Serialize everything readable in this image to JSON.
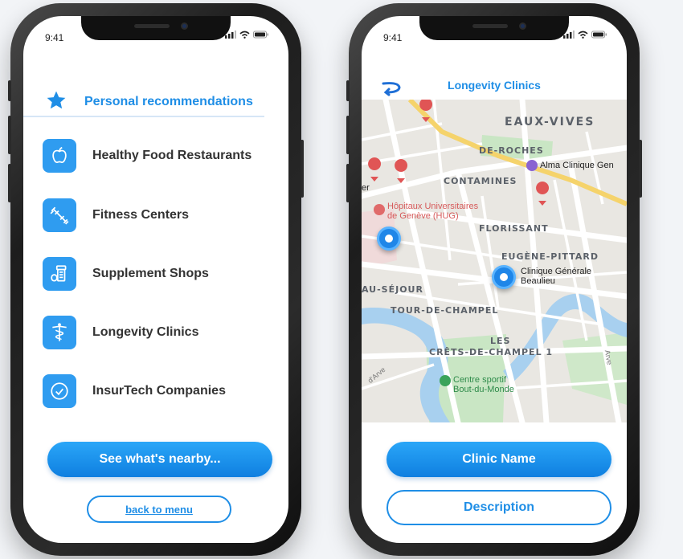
{
  "colors": {
    "accent": "#1f8ee6",
    "button_gradient_top": "#2aa6f8",
    "button_gradient_bottom": "#0f7fe0",
    "icon_tile": "#2f9cf0"
  },
  "status_bar": {
    "time": "9:41"
  },
  "left_screen": {
    "header": {
      "icon": "star-icon",
      "title": "Personal recommendations"
    },
    "categories": [
      {
        "icon": "apple-icon",
        "label": "Healthy Food Restaurants"
      },
      {
        "icon": "dumbbell-icon",
        "label": "Fitness Centers"
      },
      {
        "icon": "pill-bottle-icon",
        "label": "Supplement Shops"
      },
      {
        "icon": "caduceus-icon",
        "label": "Longevity  Clinics"
      },
      {
        "icon": "check-circle-icon",
        "label": "InsurTech Companies"
      }
    ],
    "primary_button": "See what's nearby...",
    "secondary_button": "back to menu"
  },
  "right_screen": {
    "back_icon": "back-arrow-icon",
    "title": "Longevity Clinics",
    "map": {
      "districts": [
        "EAUX-VIVES",
        "DE-ROCHES",
        "CONTAMINES",
        "FLORISSANT",
        "EUGÈNE-PITTARD",
        "AU-SÉJOUR",
        "TOUR-DE-CHAMPEL",
        "LES",
        "CRÊTS-DE-CHAMPEL 1"
      ],
      "pois": [
        {
          "name": "Alma Clinique Gen",
          "color": "#7a5cc2"
        },
        {
          "name": "Hôpitaux Universitaires",
          "color": "#d65a5a"
        },
        {
          "name": "de Genève (HUG)",
          "color": "#d65a5a"
        },
        {
          "name": "Clinique Générale",
          "color": "#222222"
        },
        {
          "name": "Beaulieu",
          "color": "#222222"
        },
        {
          "name": "Centre sportif",
          "color": "#2e8b4a"
        },
        {
          "name": "Bout-du-Monde",
          "color": "#2e8b4a"
        }
      ],
      "fragments": [
        "er",
        "d'Arve",
        "Arve"
      ]
    },
    "primary_button": "Clinic Name",
    "secondary_button": "Description"
  }
}
